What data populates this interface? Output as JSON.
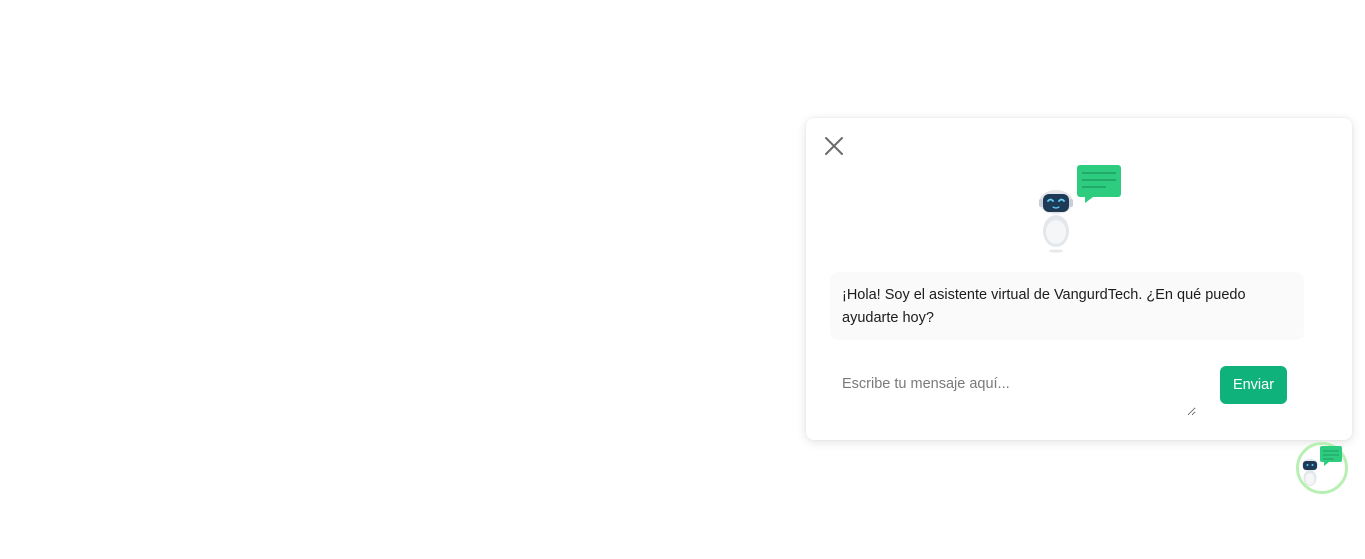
{
  "chat": {
    "greeting": "¡Hola! Soy el asistente virtual de VangurdTech. ¿En qué puedo ayudarte hoy?",
    "input_placeholder": "Escribe tu mensaje aquí...",
    "send_label": "Enviar"
  },
  "icons": {
    "close": "close-icon",
    "bot": "chatbot-robot-icon",
    "launcher": "chatbot-launcher-icon"
  },
  "colors": {
    "accent": "#0fb27b",
    "speech_bubble": "#2ecc7f",
    "launcher_ring": "#b8f0b3",
    "bot_face": "#1e3a56"
  }
}
